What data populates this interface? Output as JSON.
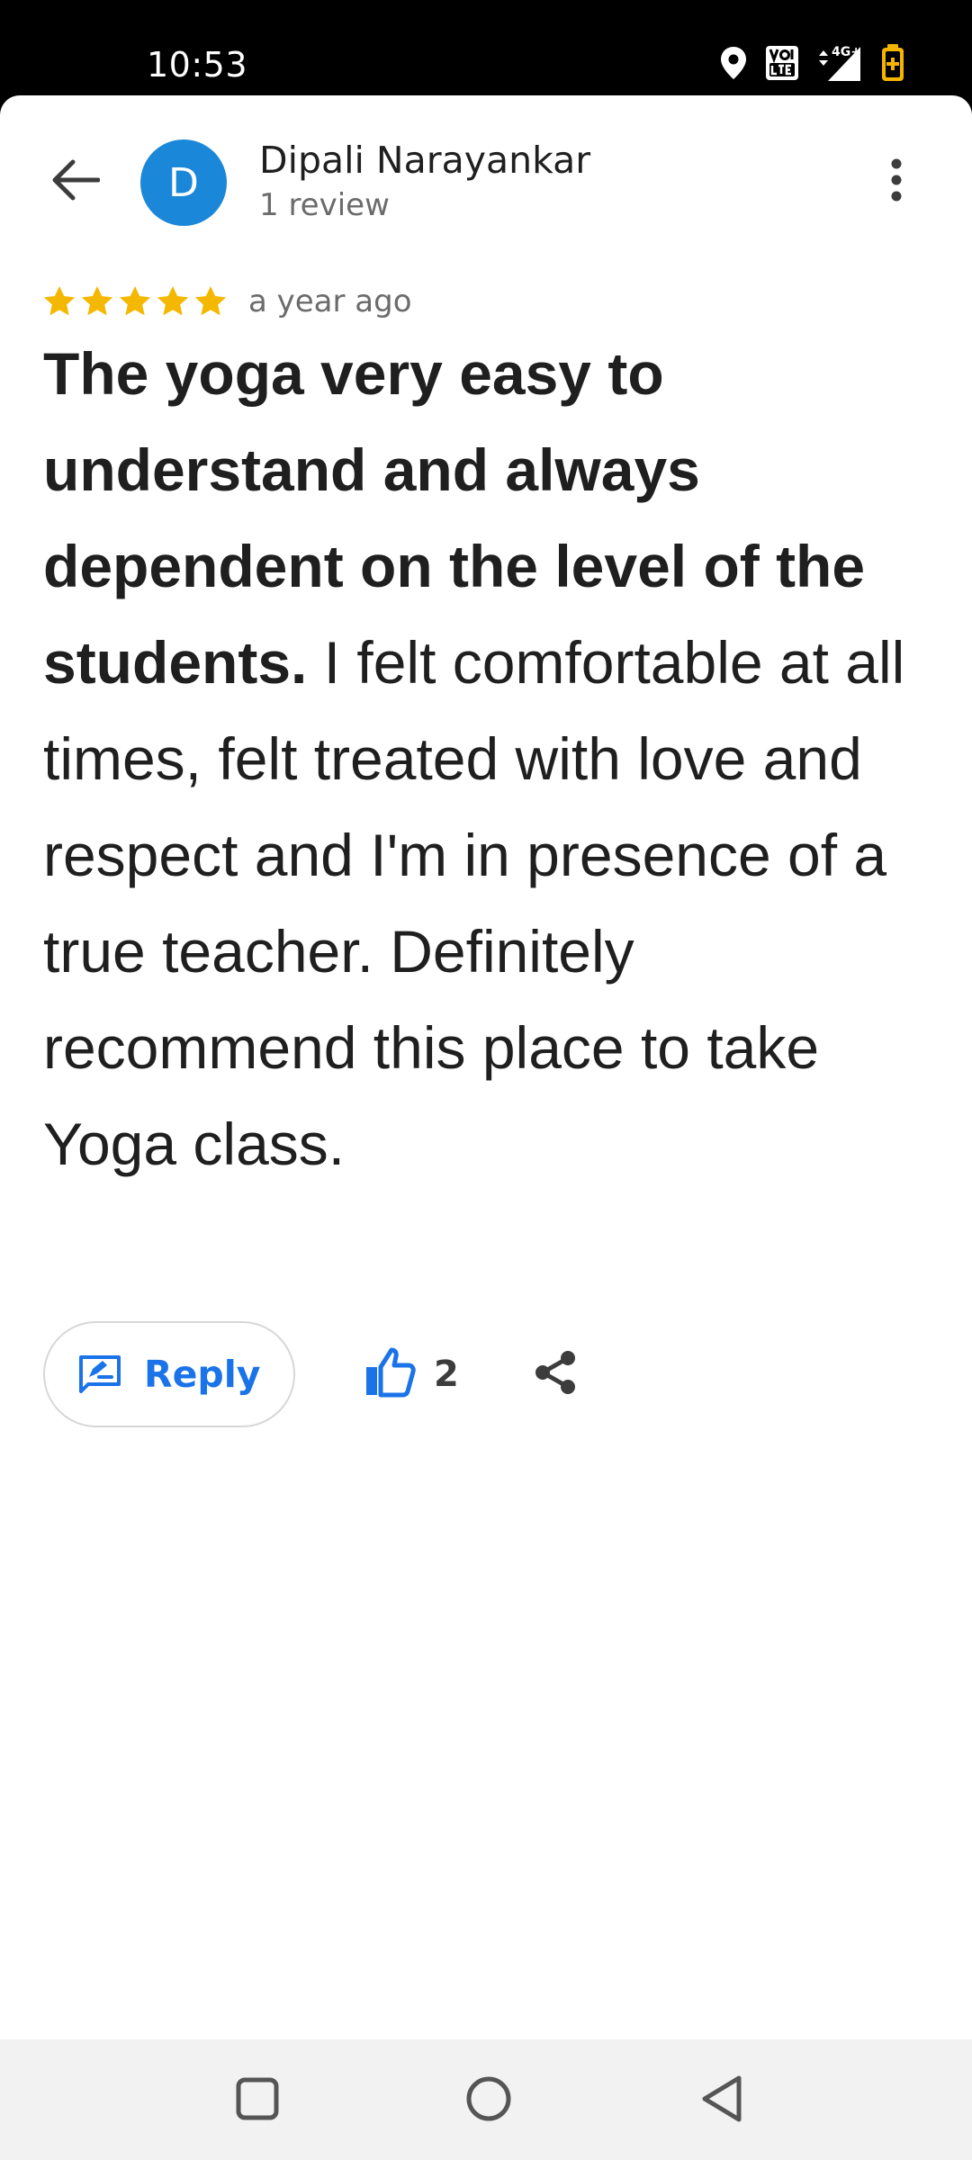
{
  "status_bar": {
    "time": "10:53",
    "icons": [
      "location-icon",
      "volte-icon",
      "4g-signal-icon",
      "battery-saver-icon"
    ]
  },
  "header": {
    "avatar_initial": "D",
    "avatar_color": "#1b87d8",
    "author_name": "Dipali Narayankar",
    "author_meta": "1 review"
  },
  "review": {
    "rating": 5,
    "max_rating": 5,
    "star_color": "#f5b800",
    "time": "a year ago",
    "lead_text": "The yoga very easy to understand and always dependent on the level of the students.",
    "body_text": " I felt comfortable at all times, felt treated with love and respect and I'm in presence of a true teacher. Definitely recommend this place to take Yoga class."
  },
  "actions": {
    "reply_label": "Reply",
    "like_count": "2",
    "accent_color": "#1a73e8"
  },
  "nav": {
    "buttons": [
      "recents-icon",
      "home-icon",
      "back-icon"
    ]
  }
}
